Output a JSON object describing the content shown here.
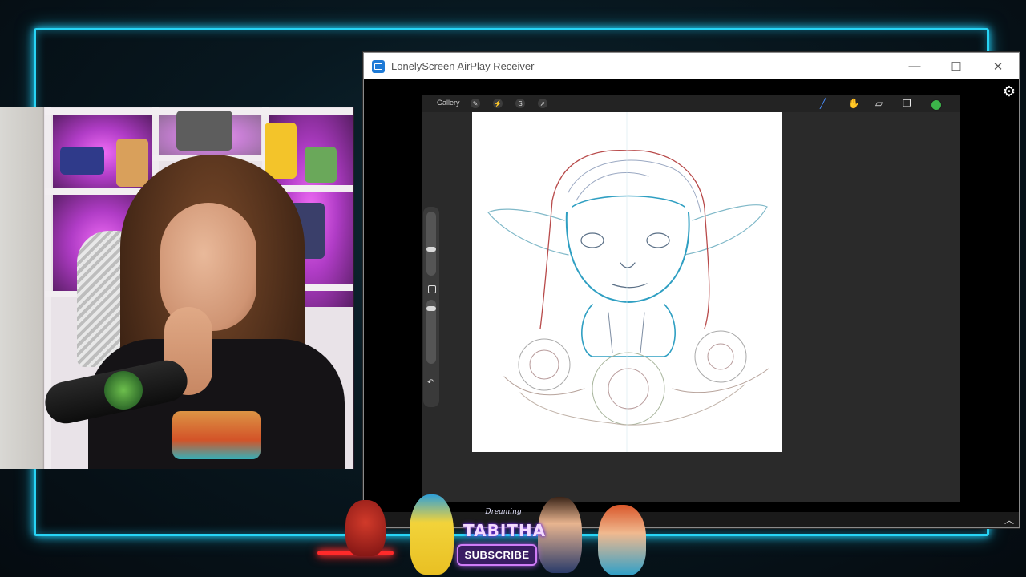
{
  "window": {
    "title": "LonelyScreen AirPlay Receiver",
    "minimize_glyph": "—",
    "maximize_glyph": "☐",
    "close_glyph": "✕",
    "settings_icon": "gear-icon"
  },
  "procreate": {
    "gallery_label": "Gallery",
    "left_tools": [
      "wrench-icon",
      "magic-wand-icon",
      "selection-icon",
      "transform-icon"
    ],
    "right_tools": [
      "brush-icon",
      "smudge-icon",
      "eraser-icon",
      "layers-icon"
    ],
    "current_color": "#3cb34a",
    "undo_glyph": "↶"
  },
  "banner": {
    "brand_small": "Dreaming",
    "brand_large": "TABITHA",
    "subscribe_label": "SUBSCRIBE"
  },
  "colors": {
    "neon_frame": "#27d4f5",
    "subscribe_border": "#d07cf7"
  }
}
